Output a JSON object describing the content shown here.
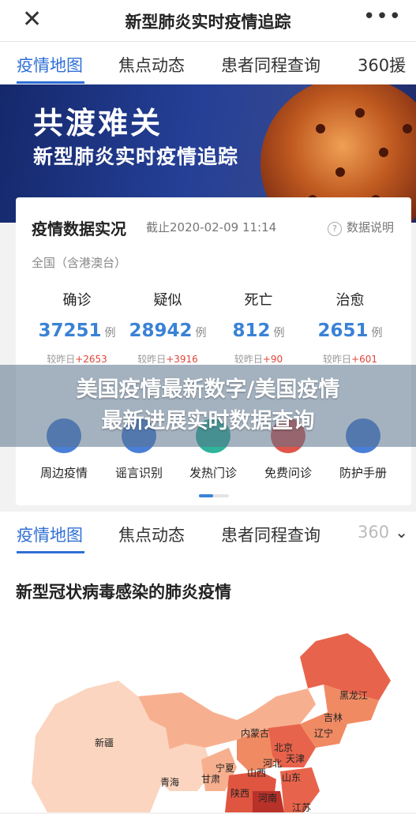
{
  "topbar": {
    "close_icon": "close-icon",
    "title": "新型肺炎实时疫情追踪",
    "more_icon": "more-icon"
  },
  "tabs": [
    {
      "label": "疫情地图",
      "active": true
    },
    {
      "label": "焦点动态",
      "active": false
    },
    {
      "label": "患者同程查询",
      "active": false
    },
    {
      "label": "360援",
      "active": false
    }
  ],
  "tabs_bottom": [
    {
      "label": "疫情地图",
      "active": true
    },
    {
      "label": "焦点动态",
      "active": false
    },
    {
      "label": "患者同程查询",
      "active": false
    },
    {
      "label": "360",
      "active": false
    }
  ],
  "banner": {
    "line1": "共渡难关",
    "line2": "新型肺炎实时疫情追踪"
  },
  "card": {
    "title": "疫情数据实况",
    "date": "截止2020-02-09 11:14",
    "help": "数据说明",
    "region": "全国（含港澳台）",
    "stats": [
      {
        "label": "确诊",
        "value": "37251",
        "unit": "例",
        "delta_label": "较昨日",
        "delta": "+2653"
      },
      {
        "label": "疑似",
        "value": "28942",
        "unit": "例",
        "delta_label": "较昨日",
        "delta": "+3916"
      },
      {
        "label": "死亡",
        "value": "812",
        "unit": "例",
        "delta_label": "较昨日",
        "delta": "+90"
      },
      {
        "label": "治愈",
        "value": "2651",
        "unit": "例",
        "delta_label": "较昨日",
        "delta": "+601"
      }
    ],
    "shortcuts": [
      {
        "label": "周边疫情",
        "icon": "location-icon",
        "color": "#4a7fd8"
      },
      {
        "label": "谣言识别",
        "icon": "shield-icon",
        "color": "#4a7fd8"
      },
      {
        "label": "发热门诊",
        "icon": "hospital-icon",
        "color": "#2fb39a"
      },
      {
        "label": "免费问诊",
        "icon": "consult-icon",
        "color": "#e0554a"
      },
      {
        "label": "防护手册",
        "icon": "book-icon",
        "color": "#4a7fd8"
      }
    ]
  },
  "overlay": {
    "line1": "美国疫情最新数字/美国疫情",
    "line2": "最新进展实时数据查询"
  },
  "map": {
    "title": "新型冠状病毒感染的肺炎疫情",
    "provinces": [
      "黑龙江",
      "吉林",
      "辽宁",
      "内蒙古",
      "北京",
      "天津",
      "河北",
      "新疆",
      "宁夏",
      "山西",
      "山东",
      "青海",
      "甘肃",
      "陕西",
      "河南",
      "江苏"
    ]
  }
}
